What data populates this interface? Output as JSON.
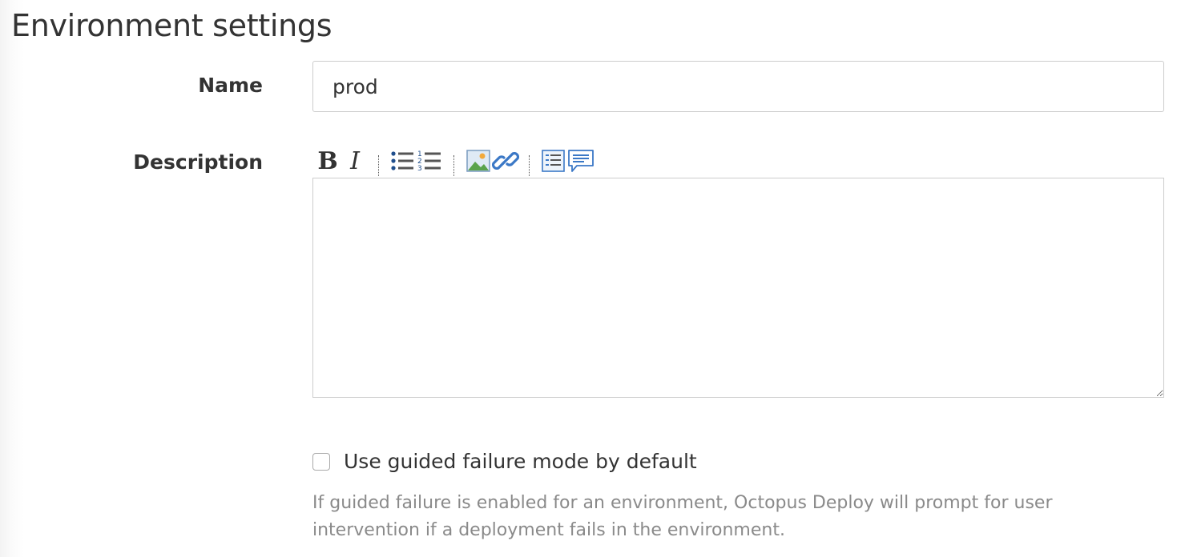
{
  "page": {
    "title": "Environment settings"
  },
  "name_field": {
    "label": "Name",
    "value": "prod"
  },
  "description_field": {
    "label": "Description",
    "value": "",
    "toolbar": [
      {
        "name": "bold",
        "glyph": "B",
        "icon": "bold-icon"
      },
      {
        "name": "italic",
        "glyph": "I",
        "icon": "italic-icon"
      },
      {
        "name": "bulleted-list",
        "icon": "bulleted-list-icon"
      },
      {
        "name": "numbered-list",
        "icon": "numbered-list-icon"
      },
      {
        "name": "image",
        "icon": "image-icon"
      },
      {
        "name": "link",
        "icon": "link-icon"
      },
      {
        "name": "preview",
        "icon": "preview-icon"
      },
      {
        "name": "help",
        "icon": "comment-icon"
      }
    ]
  },
  "guided_failure": {
    "checked": false,
    "label": "Use guided failure mode by default",
    "help": "If guided failure is enabled for an environment, Octopus Deploy will prompt for user intervention if a deployment fails in the environment."
  },
  "colors": {
    "text": "#333333",
    "help_text": "#8a8a8a",
    "border": "#cccccc",
    "link_icon": "#3b78c6"
  }
}
